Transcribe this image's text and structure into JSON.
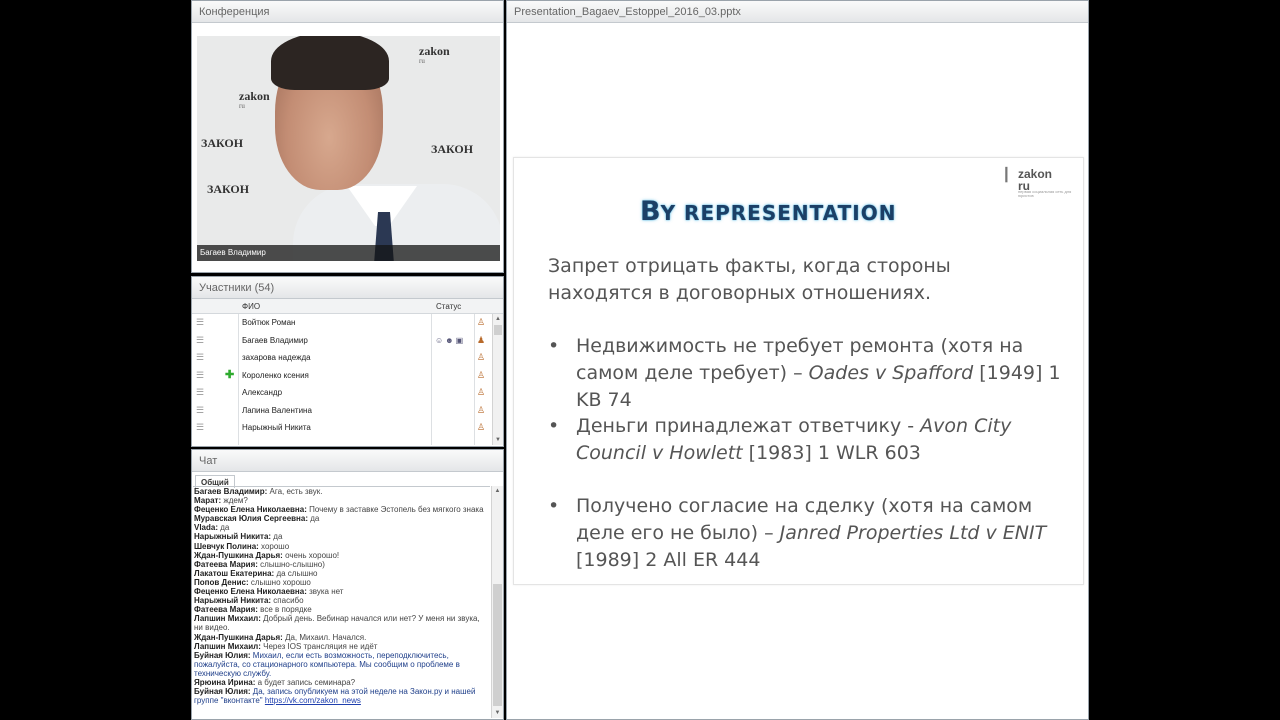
{
  "conference": {
    "title": "Конференция",
    "speaker_caption": "Багаев Владимир",
    "wall_logo_top": "zakon",
    "wall_logo_sub": "ru",
    "wall_logo_brand": "ЗАКОН"
  },
  "participants": {
    "title": "Участники (54)",
    "columns": {
      "name": "ФИО",
      "status": "Статус"
    },
    "rows": [
      {
        "name": "Войтюк Роман"
      },
      {
        "name": "Багаев Владимир"
      },
      {
        "name": "захарова  надежда"
      },
      {
        "name": "Короленко ксения"
      },
      {
        "name": "Александр"
      },
      {
        "name": "Лапина Валентина"
      },
      {
        "name": "Нарыжный Никита"
      }
    ]
  },
  "chat": {
    "title": "Чат",
    "tab": "Общий",
    "messages": [
      {
        "author": "Багаев Владимир:",
        "text": " Ага, есть звук."
      },
      {
        "author": "Марат:",
        "text": " ждем?"
      },
      {
        "author": "Феценко Елена  Николаевна:",
        "text": " Почему в заставке Эстопель без мягкого знака"
      },
      {
        "author": "Муравская Юлия Сергеевна:",
        "text": " да"
      },
      {
        "author": "Vlada:",
        "text": " да"
      },
      {
        "author": "Нарыжный Никита:",
        "text": " да"
      },
      {
        "author": "Шевчук Полина:",
        "text": " хорошо"
      },
      {
        "author": "Ждан-Пушкина Дарья:",
        "text": " очень хорошо!"
      },
      {
        "author": "Фатеева Мария:",
        "text": " слышно-слышно)"
      },
      {
        "author": "Лакатош Екатерина:",
        "text": " да слышно"
      },
      {
        "author": "Попов Денис:",
        "text": " слышно хорошо"
      },
      {
        "author": "Феценко Елена  Николаевна:",
        "text": " звука нет"
      },
      {
        "author": "Нарыжный Никита:",
        "text": " спасибо"
      },
      {
        "author": "Фатеева Мария:",
        "text": " все в порядке"
      },
      {
        "author": "Лапшин  Михаил:",
        "text": " Добрый день. Вебинар начался или нет? У меня ни звука, ни видео."
      },
      {
        "author": "Ждан-Пушкина Дарья:",
        "text": " Да, Михаил. Начался."
      },
      {
        "author": "Лапшин  Михаил:",
        "text": " Через IOS трансляция не идёт"
      },
      {
        "author": "Буйная Юлия:",
        "text": " Михаил, если есть возможность, переподключитесь, пожалуйста, со стационарного компьютера. Мы сообщим о проблеме в техническую службу.",
        "note": true
      },
      {
        "author": "Ярюина Ирина:",
        "text": " а будет запись семинара?"
      },
      {
        "author": "Буйная Юлия:",
        "text": " Да, запись опубликуем на этой неделе на Закон.ру и нашей группе \"вконтакте\" ",
        "link": "https://vk.com/zakon_news",
        "note": true
      }
    ]
  },
  "presentation": {
    "title": "Presentation_Bagaev_Estoppel_2016_03.pptx",
    "logo": {
      "main": "zakon",
      "sub": "ru",
      "tagline": "первая социальная сеть для юристов"
    },
    "slide_title_cap": "B",
    "slide_title_rest": "Y REPRESENTATION",
    "intro": "Запрет отрицать факты, когда стороны находятся в договорных отношениях.",
    "bullets": [
      {
        "text": "Недвижимость не требует ремонта (хотя на самом деле требует) – ",
        "case": "Oades v Spafford",
        "cite": " [1949] 1 KB 74"
      },
      {
        "text": "Деньги принадлежат ответчику - ",
        "case": "Avon City Council v Howlett",
        "cite": " [1983] 1 WLR 603"
      },
      {
        "text": "Получено согласие на сделку (хотя на самом деле его не было) – ",
        "case": "Janred Properties Ltd v ENIT",
        "cite": " [1989] 2 All ER 444"
      }
    ]
  }
}
